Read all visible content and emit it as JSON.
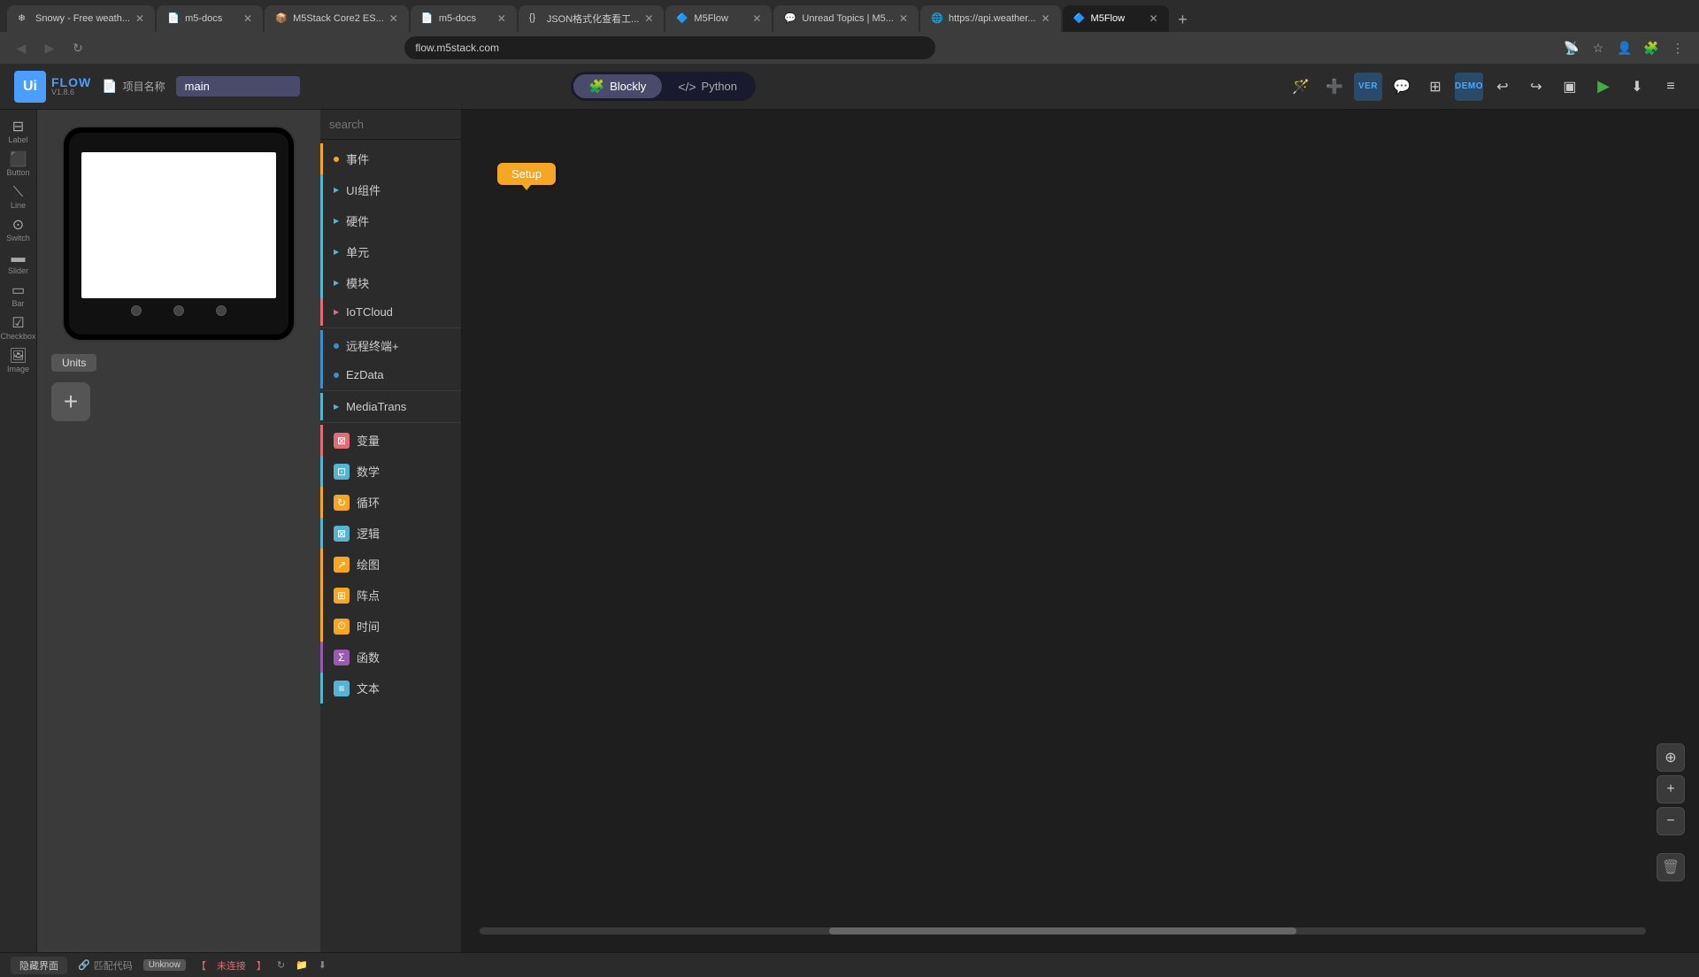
{
  "browser": {
    "address": "flow.m5stack.com",
    "tabs": [
      {
        "label": "Snowy - Free weath...",
        "favicon": "❄",
        "active": false
      },
      {
        "label": "m5-docs",
        "favicon": "📄",
        "active": false
      },
      {
        "label": "M5Stack Core2 ES...",
        "favicon": "📦",
        "active": false
      },
      {
        "label": "m5-docs",
        "favicon": "📄",
        "active": false
      },
      {
        "label": "JSON格式化查看工...",
        "favicon": "{}",
        "active": false
      },
      {
        "label": "M5Flow",
        "favicon": "🔷",
        "active": false
      },
      {
        "label": "Unread Topics | M5...",
        "favicon": "💬",
        "active": false
      },
      {
        "label": "https://api.weather...",
        "favicon": "🌐",
        "active": false
      },
      {
        "label": "M5Flow",
        "favicon": "🔷",
        "active": true
      }
    ],
    "nav": {
      "back": "◀",
      "forward": "▶",
      "refresh": "↻"
    }
  },
  "app": {
    "logo": {
      "symbol": "Ui",
      "sub": "FLOW",
      "version": "V1.8.6"
    },
    "project": {
      "label": "项目名称",
      "value": "main"
    },
    "modes": {
      "blockly": "Blockly",
      "python": "Python"
    },
    "toolbar": {
      "ver": "VER",
      "demo": "DEMO",
      "undo_icon": "↩",
      "redo_icon": "↪",
      "monitor_icon": "▣",
      "run_icon": "▶",
      "download_icon": "⬇",
      "menu_icon": "≡"
    }
  },
  "widgets": [
    {
      "icon": "⊞",
      "label": ""
    },
    {
      "icon": "⬛",
      "label": "Button"
    },
    {
      "icon": "⟍",
      "label": "Line"
    },
    {
      "icon": "⊙",
      "label": "Switch"
    },
    {
      "icon": "▬",
      "label": "Slider"
    },
    {
      "icon": "▭",
      "label": "Bar"
    },
    {
      "icon": "☑",
      "label": "Checkbox"
    },
    {
      "icon": "🖼",
      "label": "Image"
    }
  ],
  "widgetLabels": {
    "button": "Button",
    "line": "Line",
    "switch": "Switch",
    "slider": "Slider",
    "bar": "Bar",
    "checkbox": "Checkbox",
    "image": "Image",
    "label": "Label"
  },
  "categories": [
    {
      "label": "事件",
      "color": "#f5a623",
      "has_arrow": false,
      "has_dot": false,
      "divider_after": false
    },
    {
      "label": "UI组件",
      "color": "#56b4d3",
      "has_arrow": true,
      "has_dot": false,
      "divider_after": false
    },
    {
      "label": "硬件",
      "color": "#56b4d3",
      "has_arrow": true,
      "has_dot": false,
      "divider_after": false
    },
    {
      "label": "单元",
      "color": "#56b4d3",
      "has_arrow": true,
      "has_dot": false,
      "divider_after": false
    },
    {
      "label": "模块",
      "color": "#56b4d3",
      "has_arrow": true,
      "has_dot": false,
      "divider_after": false
    },
    {
      "label": "IoTCloud",
      "color": "#e06c75",
      "has_arrow": true,
      "has_dot": false,
      "divider_after": true
    },
    {
      "label": "远程终端+",
      "color": "#3a8fcf",
      "has_arrow": false,
      "has_dot": false,
      "divider_after": false
    },
    {
      "label": "EzData",
      "color": "#3a8fcf",
      "has_arrow": false,
      "has_dot": false,
      "divider_after": true
    },
    {
      "label": "MediaTrans",
      "color": "#56b4d3",
      "has_arrow": true,
      "has_dot": false,
      "divider_after": true
    },
    {
      "label": "变量",
      "color": "#e06c75",
      "has_arrow": false,
      "has_dot": true,
      "divider_after": false
    },
    {
      "label": "数学",
      "color": "#56b4d3",
      "has_arrow": false,
      "has_dot": true,
      "divider_after": false
    },
    {
      "label": "循环",
      "color": "#f5a623",
      "has_arrow": false,
      "has_dot": true,
      "divider_after": false
    },
    {
      "label": "逻辑",
      "color": "#56b4d3",
      "has_arrow": false,
      "has_dot": true,
      "divider_after": false
    },
    {
      "label": "绘图",
      "color": "#f5a623",
      "has_arrow": false,
      "has_dot": true,
      "divider_after": false
    },
    {
      "label": "阵点",
      "color": "#f5a623",
      "has_arrow": false,
      "has_dot": true,
      "divider_after": false
    },
    {
      "label": "时间",
      "color": "#f5a623",
      "has_arrow": false,
      "has_dot": true,
      "divider_after": false
    },
    {
      "label": "函数",
      "color": "#9b59b6",
      "has_arrow": false,
      "has_dot": true,
      "divider_after": false
    },
    {
      "label": "文本",
      "color": "#56b4d3",
      "has_arrow": false,
      "has_dot": true,
      "divider_after": false
    }
  ],
  "canvas": {
    "setup_block": "Setup"
  },
  "status": {
    "hide_ui": "隐藏界面",
    "match_code": "匹配代码",
    "link_icon": "🔗",
    "unknow": "Unknow",
    "not_connected": "未连接",
    "refresh_icon": "↻",
    "icons": [
      "📁",
      "⬇"
    ]
  },
  "search": {
    "placeholder": "search"
  }
}
